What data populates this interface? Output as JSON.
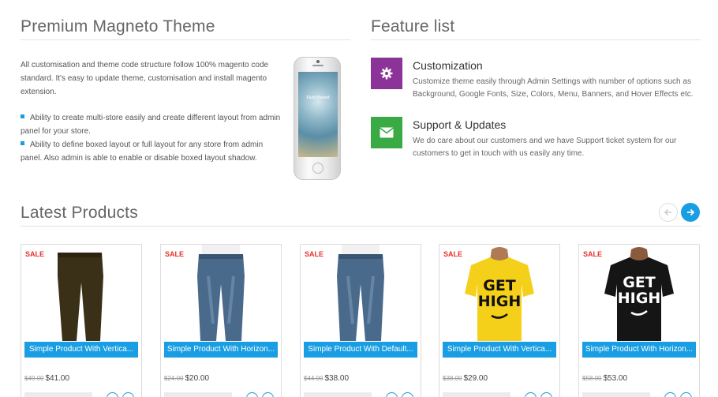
{
  "left": {
    "title": "Premium Magneto Theme",
    "intro": "All customisation and theme code structure follow 100% magento code standard. It's easy to update theme, customisation and install magento extension.",
    "bullets": [
      "Ability to create multi-store easily and create different layout from admin panel for your store.",
      "Ability to define boxed layout or full layout for any store from admin panel. Also admin is able to enable or disable boxed layout shadow."
    ],
    "phone_screen_text": "Fluid Based"
  },
  "features": {
    "title": "Feature list",
    "items": [
      {
        "icon": "gear-icon",
        "color": "#8c3399",
        "title": "Customization",
        "description": "Customize theme easily through Admin Settings with number of options such as Background, Google Fonts, Size, Colors, Menu, Banners, and Hover Effects etc."
      },
      {
        "icon": "envelope-icon",
        "color": "#3aaa45",
        "title": "Support & Updates",
        "description": "We do care about our customers and we have Support ticket system for our customers to get in touch with us easily any time."
      }
    ]
  },
  "latest": {
    "title": "Latest Products",
    "prev_icon": "arrow-left-icon",
    "next_icon": "arrow-right-icon",
    "products": [
      {
        "badge": "SALE",
        "name": "Simple Product With Vertica...",
        "old_price": "$49.00",
        "price": "$41.00",
        "image": "brown-pants"
      },
      {
        "badge": "SALE",
        "name": "Simple Product With Horizon...",
        "old_price": "$24.00",
        "price": "$20.00",
        "image": "blue-jeans"
      },
      {
        "badge": "SALE",
        "name": "Simple Product With Default...",
        "old_price": "$44.00",
        "price": "$38.00",
        "image": "blue-jeans"
      },
      {
        "badge": "SALE",
        "name": "Simple Product With Vertica...",
        "old_price": "$38.00",
        "price": "$29.00",
        "image": "yellow-tshirt"
      },
      {
        "badge": "SALE",
        "name": "Simple Product With Horizon...",
        "old_price": "$58.00",
        "price": "$53.00",
        "image": "black-tshirt"
      }
    ],
    "tshirt_text_1": "GET",
    "tshirt_text_2": "HIGH"
  }
}
